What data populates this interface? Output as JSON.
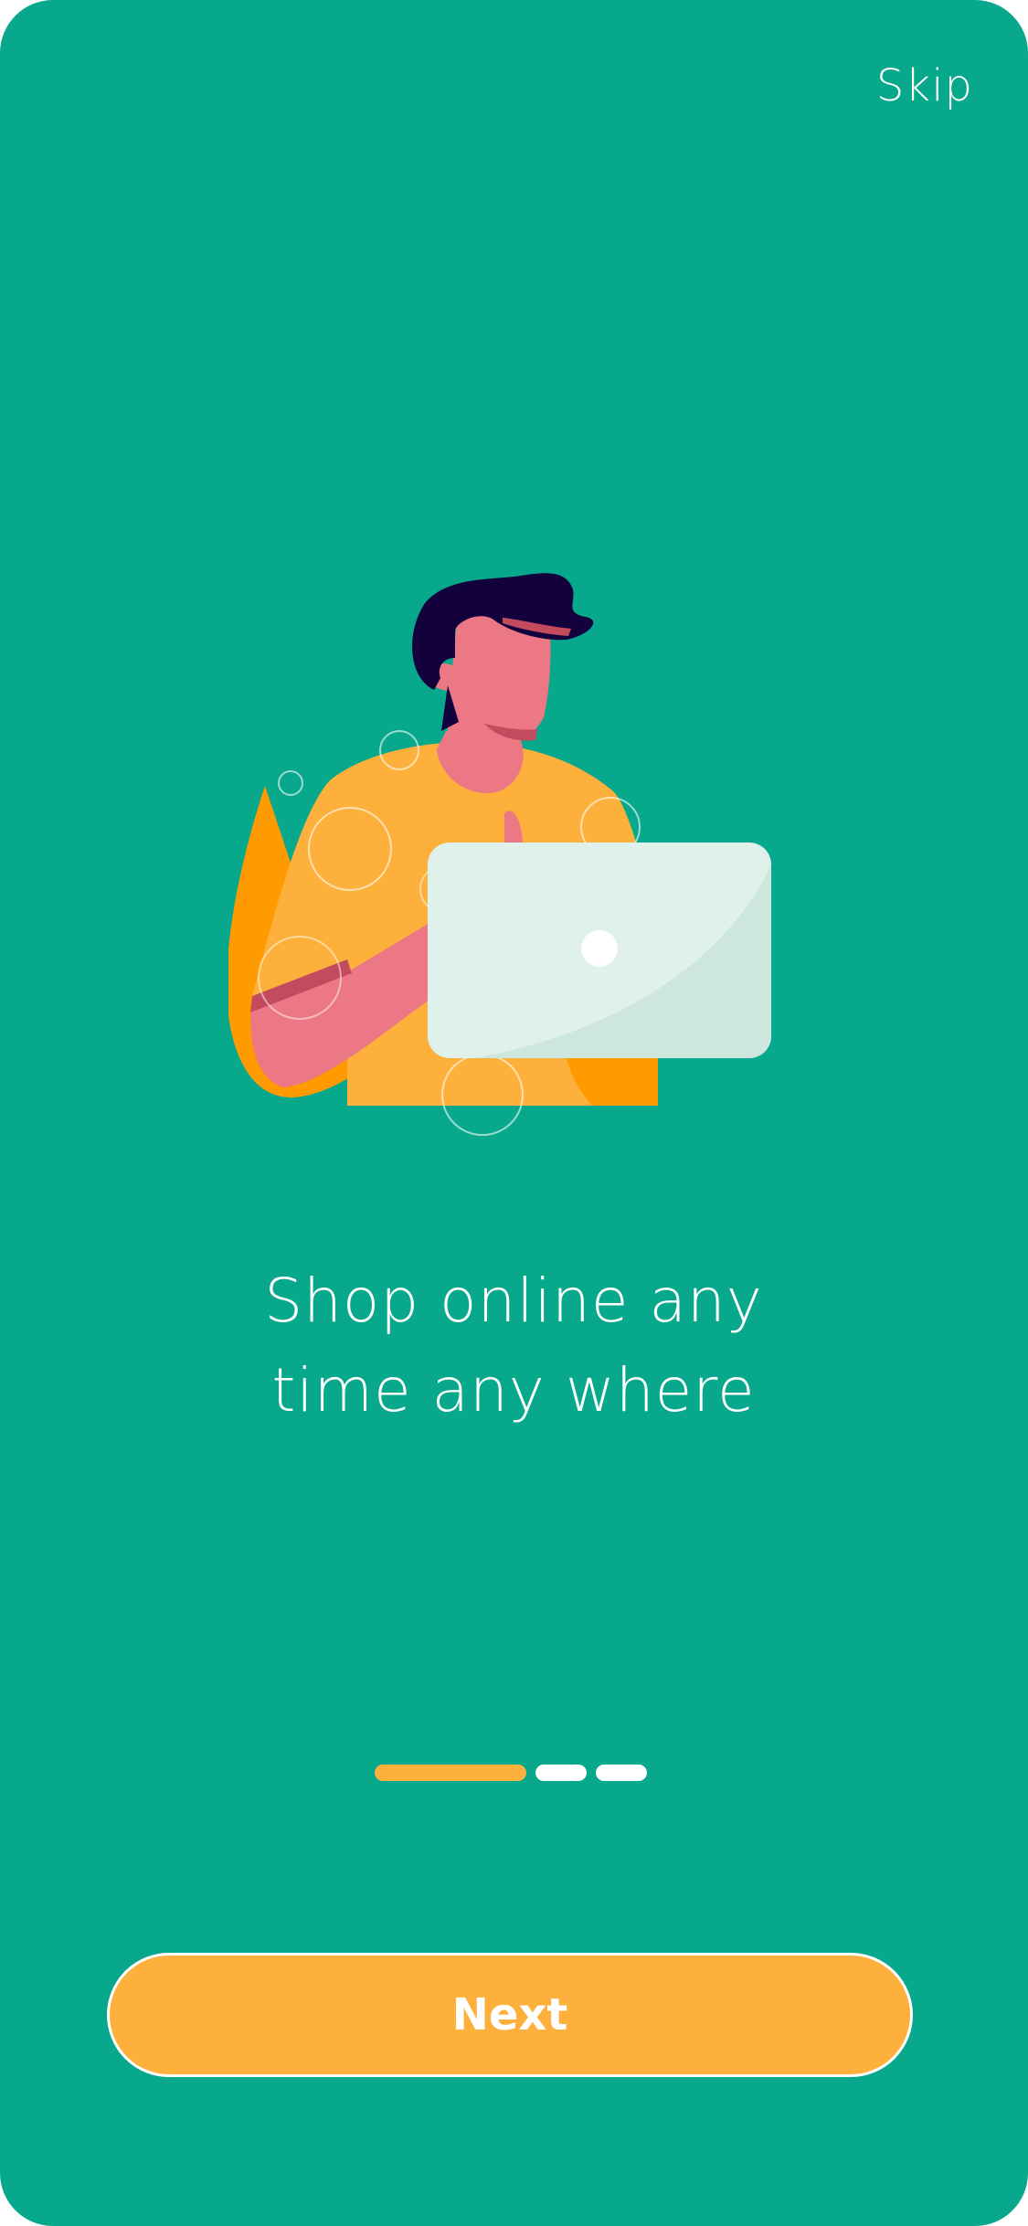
{
  "onboarding": {
    "skip_label": "Skip",
    "illustration_icon": "person-with-laptop-illustration",
    "headline_line1": "Shop online any",
    "headline_line2": "time any where",
    "pager": {
      "total": 3,
      "current": 1
    },
    "next_label": "Next"
  },
  "colors": {
    "background": "#07A88B",
    "accent": "#FDB03B",
    "text": "#FFFFFF"
  }
}
